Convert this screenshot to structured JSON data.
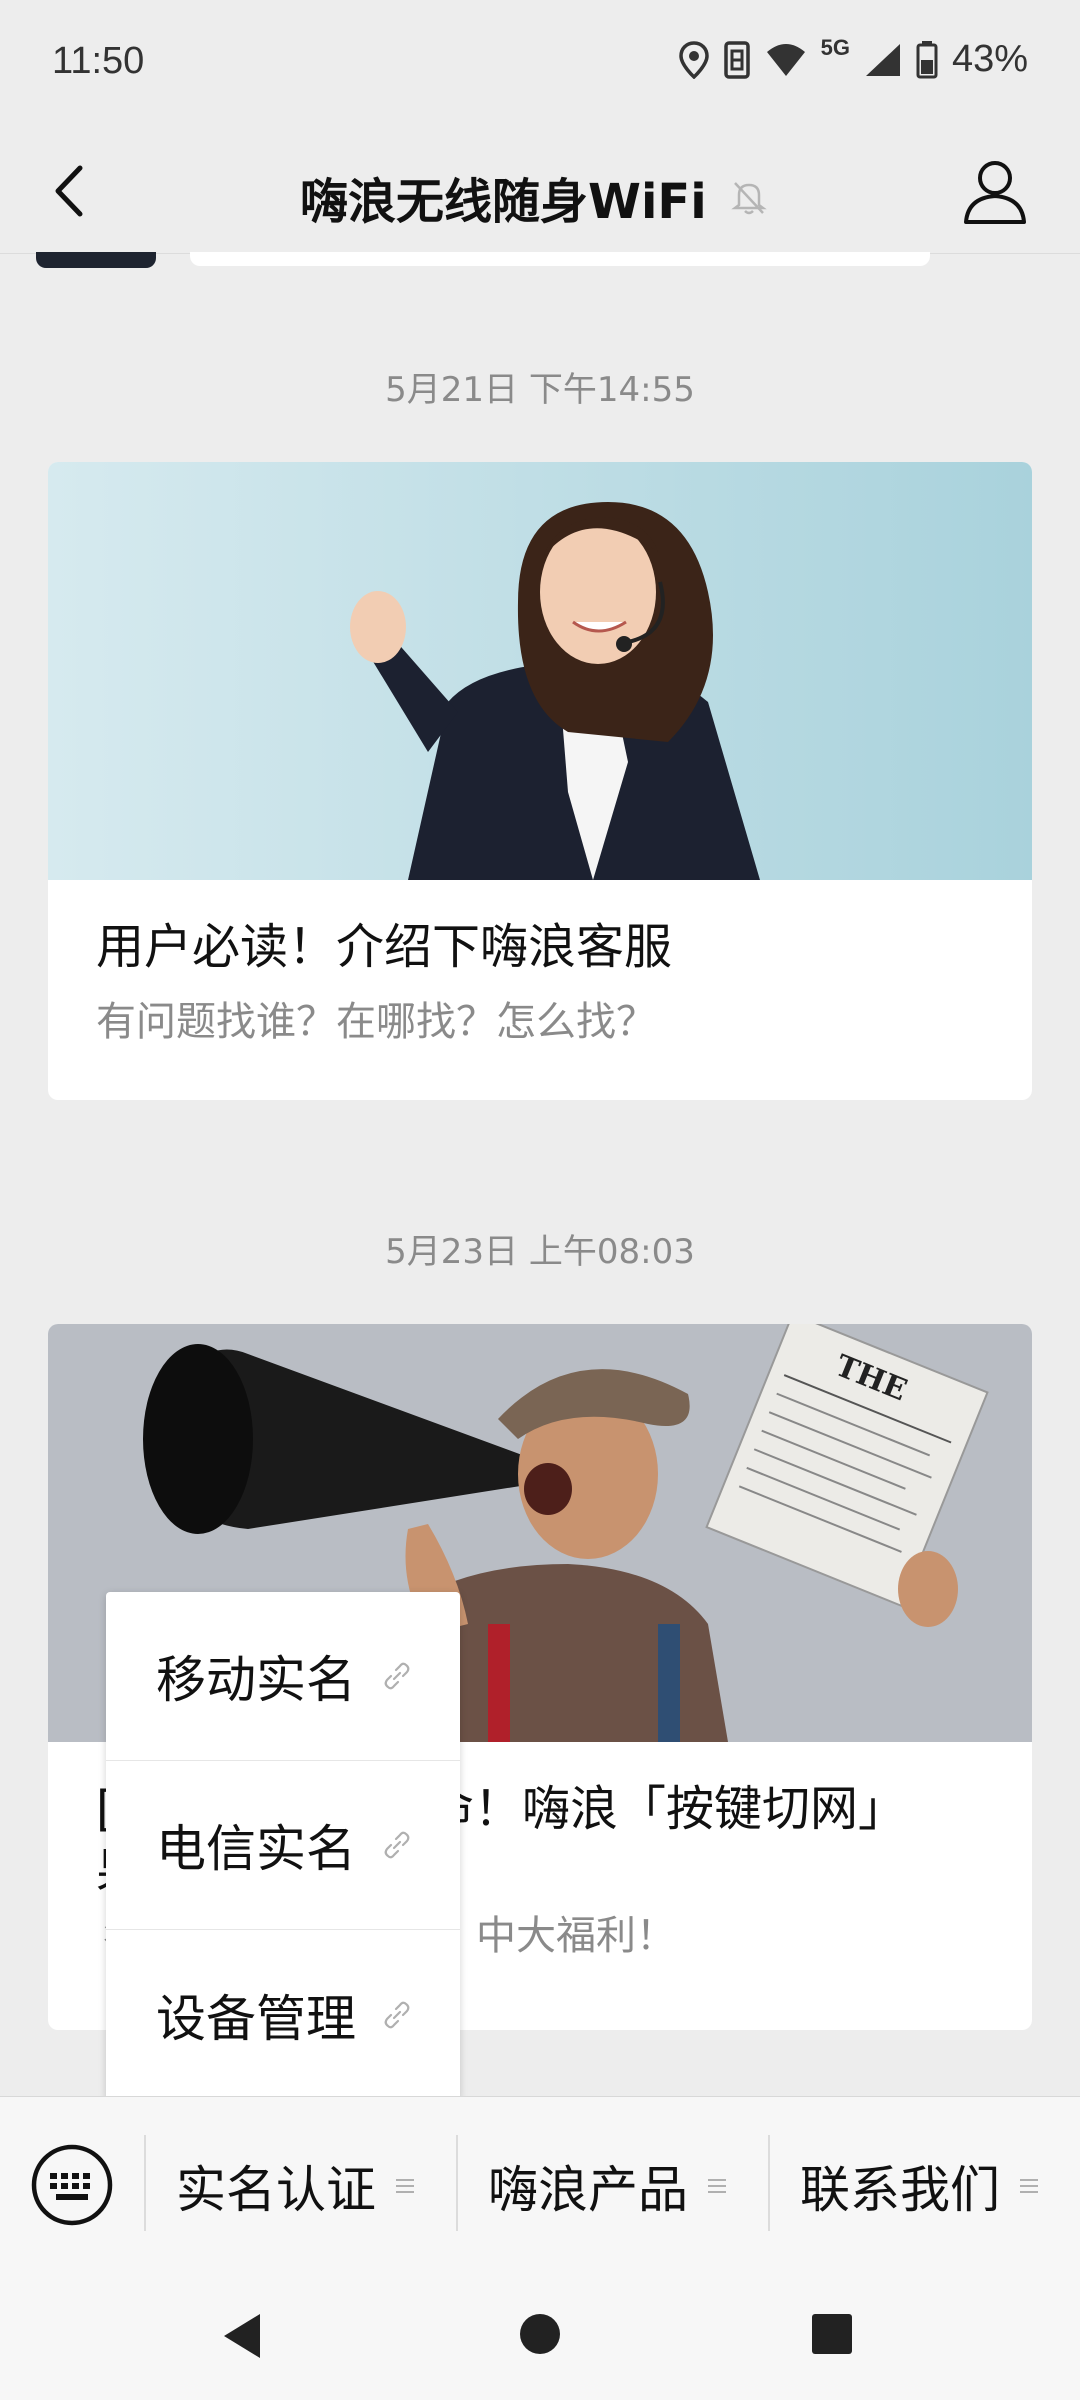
{
  "status": {
    "time": "11:50",
    "network": "5G",
    "battery": "43%",
    "icons": [
      "location-icon",
      "vibrate-icon",
      "wifi-icon",
      "signal-icon",
      "battery-icon"
    ]
  },
  "header": {
    "title": "嗨浪无线随身WiFi",
    "icons": [
      "back-arrow-icon",
      "bell-muted-icon",
      "profile-icon"
    ]
  },
  "messages": [
    {
      "timestamp": "5月21日 下午14:55",
      "title": "用户必读！介绍下嗨浪客服",
      "subtitle": "有问题找谁？在哪找？怎么找？"
    },
    {
      "timestamp": "5月23日 上午08:03",
      "title_visible_left": "[",
      "title_visible_right": "命！嗨浪「按键切网」",
      "title_line2_visible": "果",
      "subtitle_visible_left": "彳",
      "subtitle_visible_right": "中大福利！"
    }
  ],
  "popup_menu": {
    "items": [
      {
        "label": "移动实名",
        "icon": "link-icon"
      },
      {
        "label": "电信实名",
        "icon": "link-icon"
      },
      {
        "label": "设备管理",
        "icon": "link-icon"
      }
    ]
  },
  "menubar": {
    "keyboard_icon": "keyboard-icon",
    "items": [
      {
        "label": "实名认证",
        "icon": "menu-lines-icon"
      },
      {
        "label": "嗨浪产品",
        "icon": "menu-lines-icon"
      },
      {
        "label": "联系我们",
        "icon": "menu-lines-icon"
      }
    ]
  },
  "navbar": {
    "icons": [
      "nav-back-icon",
      "nav-home-icon",
      "nav-recents-icon"
    ]
  },
  "colors": {
    "background": "#ededed",
    "card": "#ffffff",
    "text_primary": "#111111",
    "text_secondary": "#8a8a8a"
  }
}
